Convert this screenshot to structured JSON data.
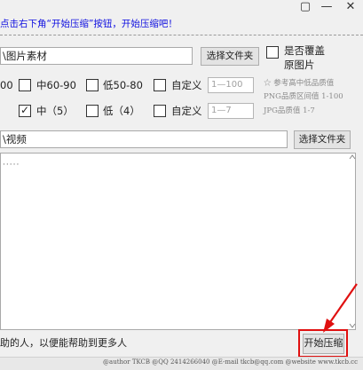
{
  "window": {
    "minimize_glyph": "—",
    "maximize_glyph": "▢",
    "close_glyph": "✕"
  },
  "hint": {
    "text": "点击右下角“开始压缩”按钮，开始压缩吧！"
  },
  "image_section": {
    "path_value": "\\图片素材",
    "browse_label": "选择文件夹",
    "overwrite_label_line1": "是否覆盖",
    "overwrite_label_line2": "原图片"
  },
  "png_quality": {
    "high_fragment": "00",
    "medium_label": "中60-90",
    "low_label": "低50-80",
    "custom_label": "自定义",
    "custom_placeholder": "1—100"
  },
  "jpg_quality": {
    "medium_label": "中（5）",
    "medium_checked": true,
    "low_label": "低（4）",
    "custom_label": "自定义",
    "custom_placeholder": "1—7"
  },
  "notes": {
    "line1": "☆ 参考高中低品质值",
    "line2": "PNG品质区间值 1-100",
    "line3": "JPG品质值 1-7"
  },
  "video_section": {
    "path_value": "\\视频",
    "browse_label": "选择文件夹"
  },
  "log": {
    "text": "·····"
  },
  "status": {
    "text": "助的人，以便能帮助到更多人"
  },
  "start_button": {
    "label": "开始压缩"
  },
  "footer": {
    "text": "@author TKCB  @QQ 2414266040  @E-mail tkcb@qq.com  @website www.tkcb.cc"
  },
  "accent_colors": {
    "hint": "#1010e0",
    "highlight": "#e01010"
  }
}
